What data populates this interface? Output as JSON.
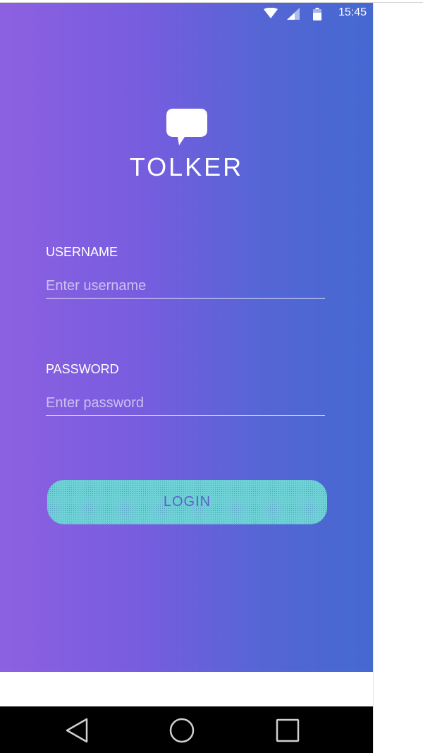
{
  "status_bar": {
    "time": "15:45",
    "icons": [
      "wifi-icon",
      "signal-icon",
      "battery-icon"
    ]
  },
  "app": {
    "name": "TOLKER",
    "logo_icon": "chat-bubble-icon"
  },
  "form": {
    "username": {
      "label": "USERNAME",
      "placeholder": "Enter username",
      "value": ""
    },
    "password": {
      "label": "PASSWORD",
      "placeholder": "Enter password",
      "value": ""
    },
    "login_label": "LOGIN"
  },
  "nav_bar": {
    "icons": [
      "back-icon",
      "home-icon",
      "recents-icon"
    ]
  },
  "colors": {
    "gradient_start": "#8d60e0",
    "gradient_end": "#4568d1",
    "button_bg": "#6fd2d6",
    "button_text": "#5a63c8",
    "text": "#ffffff"
  }
}
